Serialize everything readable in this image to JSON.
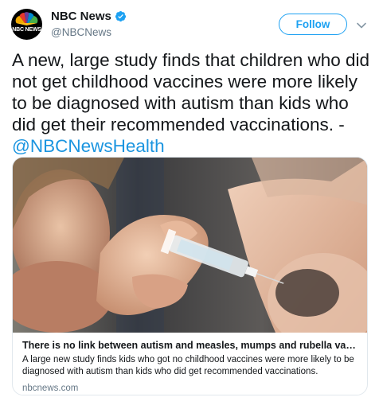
{
  "header": {
    "avatar_label": "NBC NEWS",
    "display_name": "NBC News",
    "handle": "@NBCNews",
    "follow_label": "Follow"
  },
  "tweet": {
    "text": "A new, large study finds that children who did not get childhood vaccines were more likely to be diagnosed with autism than kids who did get their recommended vaccinations. - ",
    "mention": "@NBCNewsHealth"
  },
  "card": {
    "title": "There is no link between autism and measles, mumps and rubella vaccine, ne...",
    "description": "A large new study finds kids who got no childhood vaccines were more likely to be diagnosed with autism than kids who did get recommended vaccinations.",
    "domain": "nbcnews.com"
  },
  "colors": {
    "accent": "#1da1f2",
    "mention": "#1b95e0",
    "secondary_text": "#657786",
    "border": "#e1e8ed"
  },
  "icons": {
    "avatar": "nbc-peacock-logo",
    "verified": "verified-badge-icon",
    "caret": "chevron-down-icon"
  }
}
